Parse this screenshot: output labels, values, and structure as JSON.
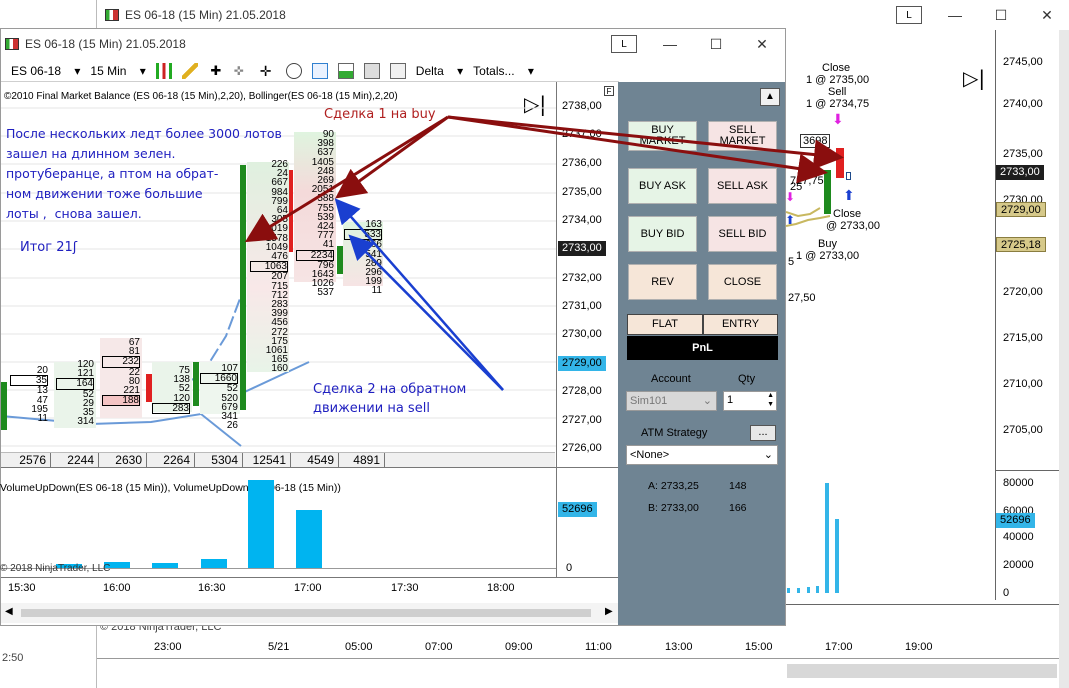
{
  "back_window": {
    "title": "ES 06-18 (15 Min)  21.05.2018",
    "l_button": "L",
    "price_axis": [
      "2745,00",
      "2740,00",
      "2735,00",
      "2730,00",
      "2725,00",
      "2720,00",
      "2715,00",
      "2710,00",
      "2705,00"
    ],
    "badges": {
      "current": "2733,00",
      "band_upper": "2729,00",
      "band_lower": "2725,18",
      "volume": "52696"
    },
    "vol_axis": [
      "80000",
      "60000",
      "40000",
      "20000",
      "0"
    ],
    "time_axis": [
      "23:00",
      "5/21",
      "05:00",
      "07:00",
      "09:00",
      "11:00",
      "13:00",
      "15:00",
      "17:00",
      "19:00"
    ],
    "trade_labels": {
      "close_top": "Close",
      "close_top_fill": "1 @ 2735,00",
      "sell": "Sell",
      "sell_fill": "1 @ 2734,75",
      "close_mid": "Close",
      "close_mid_fill": "@ 2733,00",
      "buy": "Buy",
      "buy_fill": "1 @ 2733,00",
      "ticket": "3698",
      "partial_1": "727,75",
      "partial_2": "25",
      "partial_3": "5",
      "partial_4": "27,50"
    },
    "copyright": "© 2018 NinjaTrader, LLC",
    "footer_left": "2:50"
  },
  "front_window": {
    "title": "ES 06-18 (15 Min)  21.05.2018",
    "l_button": "L",
    "toolbar": {
      "instrument": "ES 06-18",
      "interval": "15 Min",
      "delta": "Delta",
      "totals": "Totals..."
    },
    "indicator_label": "©2010 Final Market Balance  (ES 06-18 (15 Min),2,20), Bollinger(ES 06-18 (15 Min),2,20)",
    "price_axis": [
      "2738,00",
      "2737,00",
      "2736,00",
      "2735,00",
      "2734,00",
      "2733,00",
      "2732,00",
      "2731,00",
      "2730,00",
      "2729,00",
      "2728,00",
      "2727,00",
      "2726,00"
    ],
    "current_price": "2733,00",
    "band_price": "2729,00",
    "totals": [
      "2576",
      "2244",
      "2630",
      "2264",
      "5304",
      "12541",
      "4549",
      "4891"
    ],
    "volume_label": "VolumeUpDown(ES 06-18 (15 Min)), VolumeUpDown(ES 06-18 (15 Min))",
    "volume_badge": "52696",
    "vol_zero": "0",
    "copyright": "© 2018 NinjaTrader, LLC",
    "time_axis": [
      "15:30",
      "16:00",
      "16:30",
      "17:00",
      "17:30",
      "18:00"
    ],
    "annotations": {
      "blue_main": "После нескольких ледт более 3000 лотов\nзашел на длинном зелен.\nпротуберанце, а птом на обрат-\nном движении тоже большие\nлоты ,  снова зашел.",
      "itog": "Итог 21",
      "itog_tail": "ʃ",
      "deal1": "Сделка 1 на buy",
      "deal2": "Сделка 2 на обратном\nдвижении на sell"
    },
    "ladder": {
      "col1": [
        "226",
        "24",
        "667",
        "984",
        "799",
        "64",
        "305",
        "1019",
        "1578",
        "1049",
        "476",
        "1063",
        "207",
        "715",
        "712",
        "283",
        "399",
        "456",
        "272",
        "175",
        "1061",
        "165",
        "160"
      ],
      "col2": [
        "90",
        "398",
        "637",
        "1405",
        "248",
        "269",
        "2051",
        "588",
        "755",
        "539",
        "424",
        "777",
        "41",
        "2234",
        "796",
        "1643",
        "1026",
        "537"
      ],
      "col3": [
        "163",
        "533",
        "266",
        "541",
        "289",
        "296",
        "199",
        "11"
      ],
      "left_cols": [
        "20",
        "35",
        "13",
        "120",
        "121",
        "164",
        "52",
        "29",
        "35",
        "47",
        "195",
        "11",
        "67",
        "81",
        "232",
        "22",
        "80",
        "221",
        "75",
        "138",
        "52",
        "120",
        "283",
        "188",
        "107",
        "1660",
        "52",
        "520",
        "679",
        "341",
        "26",
        "314"
      ]
    },
    "trade_panel": {
      "buy_market": "BUY\nMARKET",
      "sell_market": "SELL\nMARKET",
      "buy_ask": "BUY ASK",
      "sell_ask": "SELL ASK",
      "buy_bid": "BUY BID",
      "sell_bid": "SELL BID",
      "rev": "REV",
      "close": "CLOSE",
      "flat": "FLAT",
      "entry": "ENTRY",
      "pnl": "PnL",
      "account_label": "Account",
      "qty_label": "Qty",
      "account_value": "Sim101",
      "qty_value": "1",
      "atm_label": "ATM Strategy",
      "atm_button": "...",
      "atm_value": "<None>",
      "ask_label": "A: 2733,25",
      "ask_size": "148",
      "bid_label": "B: 2733,00",
      "bid_size": "166",
      "f_marker": "F"
    }
  },
  "colors": {
    "panel": "#6f8493",
    "blue_badge": "#33b5e8",
    "gold_badge": "#d6c98a",
    "current_badge": "#1e1e1e",
    "green_candle": "#1e8a1e",
    "red_candle": "#e02020"
  }
}
